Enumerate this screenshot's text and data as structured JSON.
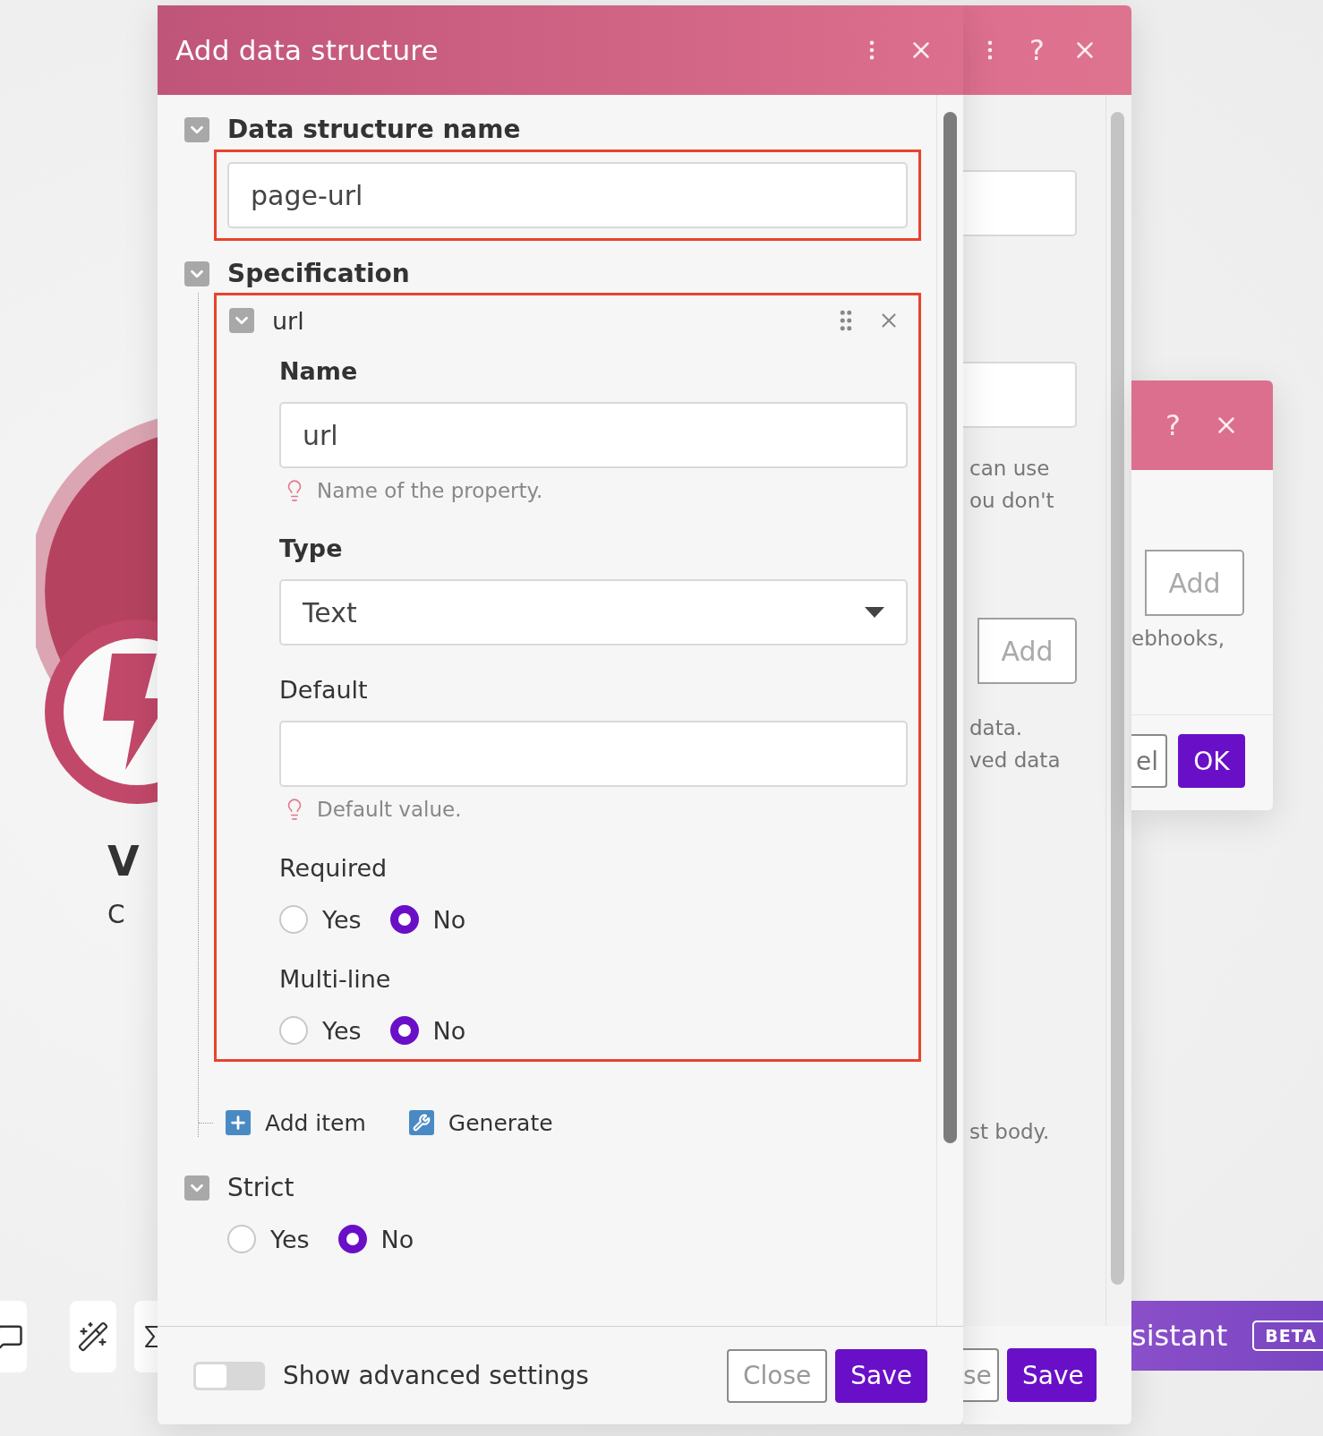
{
  "background": {
    "module_title": "V",
    "module_subtitle": "C",
    "toolbar": [
      {
        "kind": "comment"
      },
      {
        "kind": "wand"
      },
      {
        "kind": "sigma"
      }
    ]
  },
  "back_dialog": {
    "help": "?",
    "blocks": [
      {
        "kind": "field"
      },
      {
        "kind": "field"
      },
      {
        "kind": "note",
        "lines": [
          "can use",
          "ou don't"
        ]
      },
      {
        "kind": "add",
        "label": "Add"
      },
      {
        "kind": "note",
        "lines": [
          "data.",
          "ved data"
        ]
      },
      {
        "kind": "note",
        "lines": [
          "st body."
        ]
      }
    ],
    "footer": [
      {
        "label": "se",
        "kind": "secondary"
      },
      {
        "label": "Save",
        "kind": "primary"
      }
    ]
  },
  "third_dialog": {
    "help": "?",
    "add": "Add",
    "text": "ebhooks,",
    "buttons": [
      {
        "label": "el",
        "kind": "secondary"
      },
      {
        "label": "OK",
        "kind": "primary"
      }
    ]
  },
  "assistant": {
    "label": "sistant",
    "badge": "BETA"
  },
  "dialog": {
    "title": "Add data structure",
    "name_section": {
      "label": "Data structure name",
      "expanded": true,
      "highlighted": true,
      "value": "page-url"
    },
    "spec_section": {
      "label": "Specification",
      "expanded": true,
      "items": [
        {
          "title": "url",
          "expanded": true,
          "highlighted": true,
          "fields": [
            {
              "kind": "text",
              "label": "Name",
              "required": true,
              "value": "url",
              "hint": "Name of the property."
            },
            {
              "kind": "select",
              "label": "Type",
              "required": true,
              "value": "Text"
            },
            {
              "kind": "text",
              "label": "Default",
              "required": false,
              "hint": "Default value."
            },
            {
              "kind": "radio",
              "label": "Required",
              "required": false,
              "options": [
                {
                  "label": "Yes",
                  "selected": false
                },
                {
                  "label": "No",
                  "selected": true
                }
              ]
            },
            {
              "kind": "radio",
              "label": "Multi-line",
              "required": false,
              "options": [
                {
                  "label": "Yes",
                  "selected": false
                },
                {
                  "label": "No",
                  "selected": true
                }
              ]
            }
          ]
        }
      ],
      "actions": [
        {
          "kind": "add",
          "label": "Add item"
        },
        {
          "kind": "generate",
          "label": "Generate"
        }
      ]
    },
    "strict": {
      "label": "Strict",
      "expanded": true,
      "options": [
        {
          "label": "Yes",
          "selected": false
        },
        {
          "label": "No",
          "selected": true
        }
      ]
    },
    "footer": {
      "advanced": {
        "label": "Show advanced settings",
        "on": false
      },
      "buttons": [
        {
          "label": "Close",
          "kind": "secondary"
        },
        {
          "label": "Save",
          "kind": "primary"
        }
      ]
    }
  }
}
